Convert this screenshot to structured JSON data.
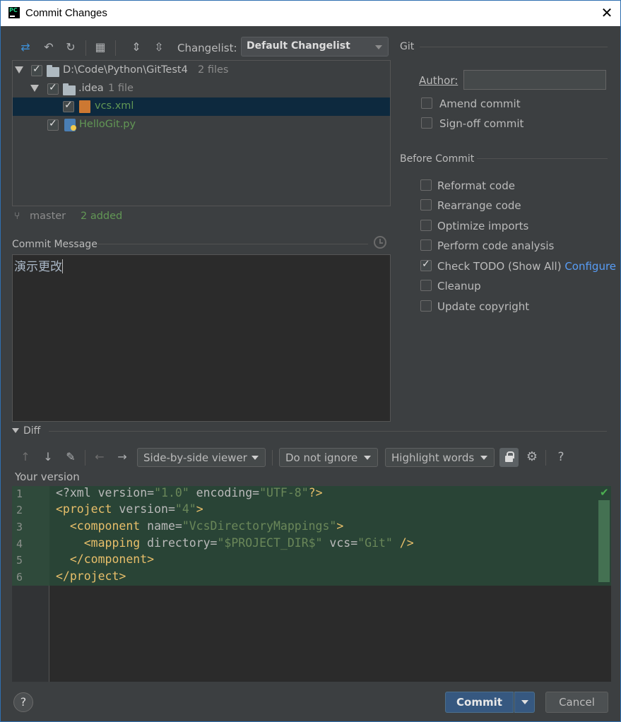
{
  "window": {
    "title": "Commit Changes",
    "close_glyph": "✕"
  },
  "toolbar": {
    "changelist_label": "Changelist:",
    "changelist_value": "Default Changelist"
  },
  "tree": {
    "root": {
      "path": "D:\\Code\\Python\\GitTest4",
      "count": "2 files"
    },
    "idea": {
      "name": ".idea",
      "count": "1 file"
    },
    "vcs": {
      "name": "vcs.xml"
    },
    "hello": {
      "name": "HelloGit.py"
    }
  },
  "status": {
    "branch": "master",
    "added": "2 added"
  },
  "commit_message": {
    "label": "Commit Message",
    "text": "演示更改"
  },
  "git": {
    "header": "Git",
    "author_label": "Author:",
    "author_value": "",
    "amend": "Amend commit",
    "signoff": "Sign-off commit"
  },
  "before_commit": {
    "header": "Before Commit",
    "reformat": "Reformat code",
    "rearrange": "Rearrange code",
    "optimize": "Optimize imports",
    "analysis": "Perform code analysis",
    "todo": "Check TODO (Show All)",
    "todo_link": "Configure",
    "cleanup": "Cleanup",
    "copyright": "Update copyright"
  },
  "diff": {
    "label": "Diff",
    "viewer": "Side-by-side viewer",
    "ignore": "Do not ignore",
    "highlight": "Highlight words",
    "your_version": "Your version",
    "line_numbers": [
      "1",
      "2",
      "3",
      "4",
      "5",
      "6"
    ]
  },
  "buttons": {
    "commit": "Commit",
    "cancel": "Cancel",
    "help": "?"
  },
  "colors": {
    "accent": "#365880",
    "added_green": "#629755",
    "link": "#589df6",
    "diff_bg": "#294436"
  }
}
